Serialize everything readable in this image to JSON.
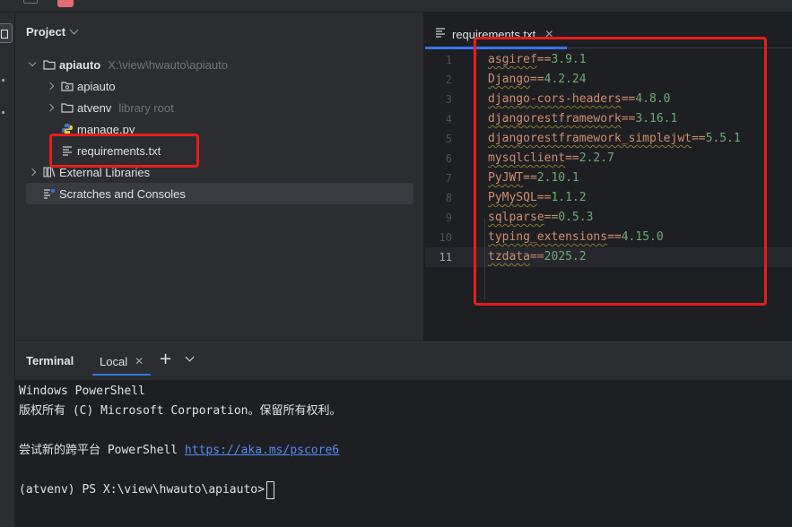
{
  "colors": {
    "accent": "#3574f0",
    "highlight_box": "#e81c1c",
    "package_name": "#cf8e6d",
    "version": "#6aab73",
    "link": "#548af7"
  },
  "project_panel": {
    "title": "Project",
    "tree": {
      "root": {
        "name": "apiauto",
        "path": "X:\\view\\hwauto\\apiauto",
        "icon": "folder-icon"
      },
      "children": [
        {
          "name": "apiauto",
          "icon": "package-folder-icon"
        },
        {
          "name": "atvenv",
          "note": "library root",
          "icon": "folder-icon"
        },
        {
          "name": "manage.py",
          "icon": "python-file-icon"
        },
        {
          "name": "requirements.txt",
          "icon": "text-file-icon"
        }
      ],
      "external_libraries": "External Libraries",
      "scratches": "Scratches and Consoles"
    }
  },
  "editor": {
    "tab_label": "requirements.txt",
    "current_line": 11,
    "lines": [
      {
        "num": "1",
        "pkg": "asgiref",
        "op": "==",
        "ver": "3.9.1"
      },
      {
        "num": "2",
        "pkg": "Django",
        "op": "==",
        "ver": "4.2.24"
      },
      {
        "num": "3",
        "pkg": "django-cors-headers",
        "op": "==",
        "ver": "4.8.0"
      },
      {
        "num": "4",
        "pkg": "djangorestframework",
        "op": "==",
        "ver": "3.16.1"
      },
      {
        "num": "5",
        "pkg": "djangorestframework_simplejwt",
        "op": "==",
        "ver": "5.5.1"
      },
      {
        "num": "6",
        "pkg": "mysqlclient",
        "op": "==",
        "ver": "2.2.7"
      },
      {
        "num": "7",
        "pkg": "PyJWT",
        "op": "==",
        "ver": "2.10.1"
      },
      {
        "num": "8",
        "pkg": "PyMySQL",
        "op": "==",
        "ver": "1.1.2"
      },
      {
        "num": "9",
        "pkg": "sqlparse",
        "op": "==",
        "ver": "0.5.3"
      },
      {
        "num": "10",
        "pkg": "typing_extensions",
        "op": "==",
        "ver": "4.15.0"
      },
      {
        "num": "11",
        "pkg": "tzdata",
        "op": "==",
        "ver": "2025.2"
      }
    ]
  },
  "terminal": {
    "title": "Terminal",
    "tab_label": "Local",
    "lines": {
      "l1": "Windows PowerShell",
      "l2": "版权所有 (C) Microsoft Corporation。保留所有权利。",
      "l3_text": "尝试新的跨平台 PowerShell ",
      "l3_link": "https://aka.ms/pscore6",
      "prompt": "(atvenv) PS X:\\view\\hwauto\\apiauto>"
    }
  }
}
